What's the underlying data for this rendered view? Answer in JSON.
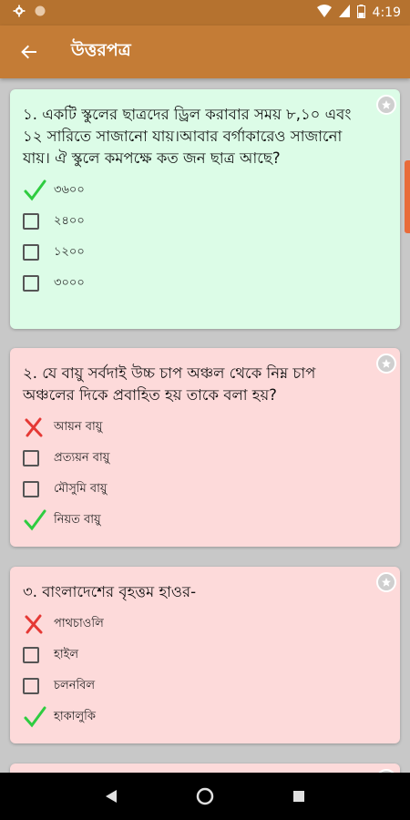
{
  "status_bar": {
    "time": "4:19",
    "icons": [
      "gear-icon",
      "circle-icon",
      "wifi-icon",
      "signal-icon",
      "battery-icon"
    ]
  },
  "app_bar": {
    "title": "উত্তরপত্র",
    "back_icon": "arrow-back-icon"
  },
  "colors": {
    "status_bar": "#b5722f",
    "app_bar": "#c47c36",
    "correct_card": "#dcfce7",
    "wrong_card": "#fddada",
    "check_green": "#2ecc40",
    "cross_red": "#e53935"
  },
  "questions": [
    {
      "text": "১. একটি স্কুলের ছাত্রদের ড্রিল করাবার সময় ৮,১০ এবং ১২ সারিতে সাজানো যায়।আবার বর্গাকারেও সাজানো যায়। ঐ স্কুলে কমপক্ষে কত জন ছাত্র আছে?",
      "status": "correct",
      "options": [
        {
          "label": "৩৬০০",
          "mark": "check"
        },
        {
          "label": "২৪০০",
          "mark": "box"
        },
        {
          "label": "১২০০",
          "mark": "box"
        },
        {
          "label": "৩০০০",
          "mark": "box"
        }
      ]
    },
    {
      "text": "২. যে বায়ু সর্বদাই উচ্চ চাপ অঞ্চল থেকে নিম্ন চাপ অঞ্চলের দিকে প্রবাহিত হয় তাকে বলা হয়?",
      "status": "wrong",
      "options": [
        {
          "label": "আয়ন বায়ু",
          "mark": "cross"
        },
        {
          "label": "প্রত্যয়ন বায়ু",
          "mark": "box"
        },
        {
          "label": "মৌসুমি বায়ু",
          "mark": "box"
        },
        {
          "label": "নিয়ত বায়ু",
          "mark": "check"
        }
      ]
    },
    {
      "text": "৩. বাংলাদেশের বৃহত্তম হাওর-",
      "status": "wrong",
      "options": [
        {
          "label": "পাথচাওলি",
          "mark": "cross"
        },
        {
          "label": "হাইল",
          "mark": "box"
        },
        {
          "label": "চলনবিল",
          "mark": "box"
        },
        {
          "label": "হাকালুকি",
          "mark": "check"
        }
      ]
    }
  ]
}
